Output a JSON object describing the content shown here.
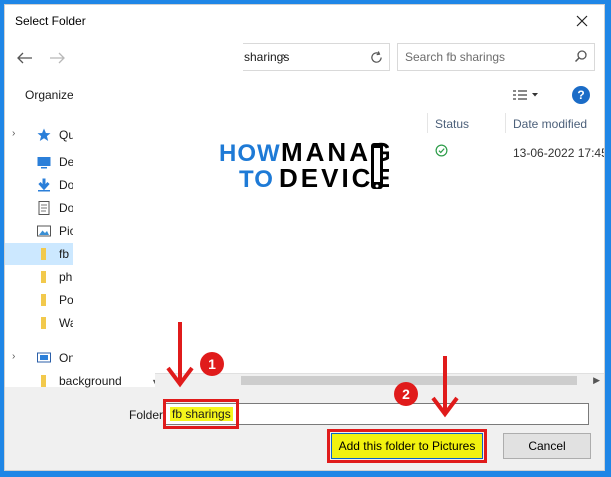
{
  "dialog": {
    "title": "Select Folder"
  },
  "address": {
    "path_tail": "sharings",
    "chevron": "›"
  },
  "search": {
    "placeholder": "Search fb sharings"
  },
  "toolbar": {
    "organize_label": "Organize"
  },
  "nav": {
    "items": [
      {
        "label": "Quic",
        "icon": "star-icon",
        "chevron": "›"
      },
      {
        "label": "De",
        "icon": "desktop-icon"
      },
      {
        "label": "Do",
        "icon": "download-icon"
      },
      {
        "label": "Do",
        "icon": "document-icon"
      },
      {
        "label": "Pic",
        "icon": "pictures-icon"
      },
      {
        "label": "fb",
        "icon": "folder-icon",
        "selected": true
      },
      {
        "label": "ph",
        "icon": "folder-icon"
      },
      {
        "label": "Po",
        "icon": "folder-icon"
      },
      {
        "label": "Wa",
        "icon": "folder-icon"
      },
      {
        "label": "One",
        "icon": "onedrive-icon",
        "chevron": "›"
      },
      {
        "label": "background",
        "icon": "folder-icon"
      }
    ]
  },
  "columns": {
    "status": "Status",
    "date_modified": "Date modified"
  },
  "file_row": {
    "status_icon": "check-circle-icon",
    "date": "13-06-2022 17:45"
  },
  "logo": {
    "how": "HOW",
    "to": "TO",
    "manage": "MANAGE",
    "devices": "DEVICES"
  },
  "footer": {
    "folder_label": "Folder:",
    "folder_value": "fb sharings",
    "add_button": "Add this folder to Pictures",
    "cancel_button": "Cancel"
  },
  "annotations": {
    "badge1": "1",
    "badge2": "2"
  },
  "colors": {
    "frame": "#1f86e6",
    "highlight": "#f2f20f",
    "annotation_red": "#e01b1b",
    "selection": "#cce8ff",
    "logo_blue": "#1e7ad6"
  }
}
